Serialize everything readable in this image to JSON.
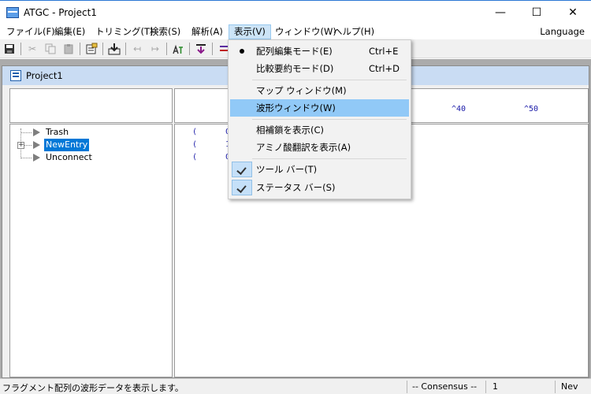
{
  "window": {
    "title": "ATGC - Project1",
    "min_glyph": "—",
    "max_glyph": "☐",
    "close_glyph": "✕"
  },
  "menu": {
    "items": [
      "ファイル(F)",
      "編集(E)",
      "トリミング(T)",
      "検索(S)",
      "解析(A)",
      "表示(V)",
      "ウィンドウ(W)",
      "ヘルプ(H)"
    ],
    "active": "表示(V)",
    "language": "Language"
  },
  "toolbar": {
    "icons": [
      "save-icon",
      "cut-icon",
      "copy-icon",
      "paste-icon",
      "properties-icon",
      "import-icon",
      "undo-icon",
      "redo-icon",
      "atgc-icon",
      "trim-icon",
      "align-icon"
    ]
  },
  "child": {
    "title": "Project1"
  },
  "ruler": {
    "marks": [
      "^40",
      "^50"
    ]
  },
  "tree": {
    "items": [
      {
        "label": "Trash",
        "selected": false,
        "expandable": false
      },
      {
        "label": "NewEntry",
        "selected": true,
        "expandable": true
      },
      {
        "label": "Unconnect",
        "selected": false,
        "expandable": false
      }
    ]
  },
  "sequence": {
    "lines": [
      "(      O",
      "(      1",
      "(      O"
    ]
  },
  "dropdown": {
    "items": [
      {
        "label": "配列編集モード(E)",
        "shortcut": "Ctrl+E",
        "mark": "bullet",
        "hover": false
      },
      {
        "label": "比較要約モード(D)",
        "shortcut": "Ctrl+D",
        "mark": "",
        "hover": false
      },
      {
        "label": "マップ ウィンドウ(M)",
        "shortcut": "",
        "mark": "",
        "hover": false
      },
      {
        "label": "波形ウィンドウ(W)",
        "shortcut": "",
        "mark": "",
        "hover": true
      },
      {
        "label": "相補鎖を表示(C)",
        "shortcut": "",
        "mark": "",
        "hover": false
      },
      {
        "label": "アミノ酸翻訳を表示(A)",
        "shortcut": "",
        "mark": "",
        "hover": false
      },
      {
        "label": "ツール バー(T)",
        "shortcut": "",
        "mark": "check",
        "hover": false
      },
      {
        "label": "ステータス バー(S)",
        "shortcut": "",
        "mark": "check",
        "hover": false
      }
    ]
  },
  "status": {
    "message": "フラグメント配列の波形データを表示します。",
    "consensus": "-- Consensus --",
    "position": "1",
    "mode": "Nev"
  },
  "colors": {
    "accent": "#0078d7",
    "menu_hover": "#91c9f7",
    "sequence_text": "#1a1aa8"
  }
}
